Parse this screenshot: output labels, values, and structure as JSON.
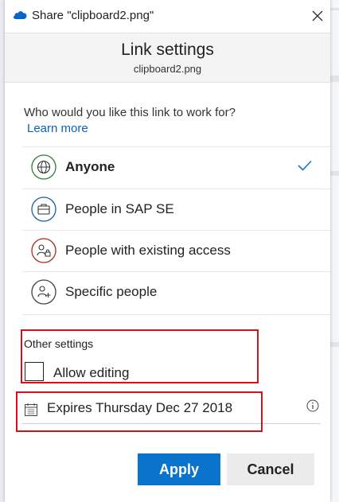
{
  "window": {
    "title": "Share \"clipboard2.png\"",
    "close_icon": "close-icon",
    "app_icon": "onedrive-cloud-icon"
  },
  "header": {
    "title": "Link settings",
    "subtitle": "clipboard2.png"
  },
  "audience": {
    "question": "Who would you like this link to work for?",
    "learn_more": "Learn more",
    "options": [
      {
        "label": "Anyone",
        "icon": "globe-icon",
        "color": "#2e7d32",
        "selected": true
      },
      {
        "label": "People in SAP SE",
        "icon": "briefcase-icon",
        "color": "#1560a8",
        "selected": false
      },
      {
        "label": "People with existing access",
        "icon": "people-lock-icon",
        "color": "#b3261e",
        "selected": false
      },
      {
        "label": "Specific people",
        "icon": "people-add-icon",
        "color": "#444444",
        "selected": false
      }
    ]
  },
  "other_settings": {
    "heading": "Other settings",
    "allow_editing": {
      "label": "Allow editing",
      "checked": false
    },
    "expiration": {
      "label": "Expires Thursday Dec 27 2018",
      "icon": "calendar-icon"
    },
    "info_icon": "info-icon"
  },
  "actions": {
    "apply": "Apply",
    "cancel": "Cancel"
  },
  "colors": {
    "accent": "#0a73cc",
    "link": "#0a63b5",
    "highlight": "#d0131b"
  }
}
